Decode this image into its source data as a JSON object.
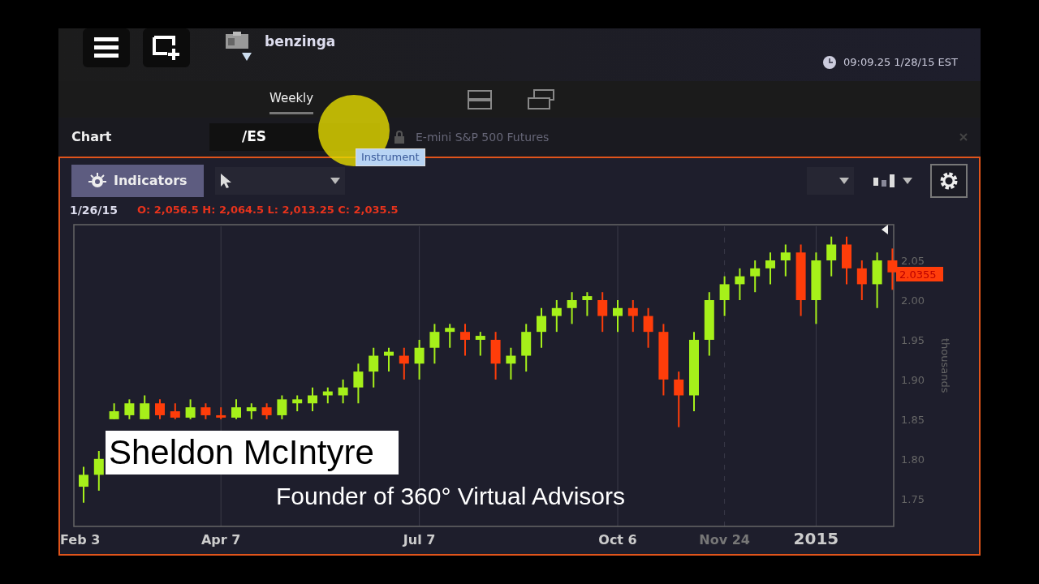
{
  "account": {
    "name": "benzinga"
  },
  "clock": {
    "time": "09:09.25 1/28/15 EST"
  },
  "tabs": [
    {
      "label": "Weekly",
      "selected": true
    }
  ],
  "panel": {
    "title": "Chart",
    "instrument": {
      "value": "/ES"
    },
    "description": "E-mini S&P 500 Futures",
    "tooltip": "Instrument"
  },
  "toolbar": {
    "indicators_button": "Indicators"
  },
  "ohlc": {
    "date": "1/26/15",
    "values": "O: 2,056.5 H: 2,064.5 L: 2,013.25 C: 2,035.5"
  },
  "chart": {
    "price_tag": "2.0355",
    "chart_data": {
      "type": "candlestick",
      "ylabel": "thousands",
      "categories": [
        "Feb 3",
        null,
        null,
        null,
        null,
        null,
        null,
        null,
        null,
        "Apr 7",
        null,
        null,
        null,
        null,
        null,
        null,
        null,
        null,
        null,
        null,
        null,
        null,
        "Jul 7",
        null,
        null,
        null,
        null,
        null,
        null,
        null,
        null,
        null,
        null,
        null,
        null,
        "Oct 6",
        null,
        null,
        null,
        null,
        null,
        null,
        "Nov 24",
        null,
        null,
        null,
        null,
        null,
        "2015",
        null,
        null,
        null,
        null,
        null
      ],
      "ylim": [
        1.715,
        2.095
      ],
      "grid": true,
      "ohlc": [
        [
          1.765,
          1.79,
          1.745,
          1.78
        ],
        [
          1.78,
          1.81,
          1.76,
          1.8
        ],
        [
          1.85,
          1.87,
          1.85,
          1.86
        ],
        [
          1.855,
          1.875,
          1.85,
          1.87
        ],
        [
          1.85,
          1.88,
          1.85,
          1.87
        ],
        [
          1.87,
          1.875,
          1.85,
          1.855
        ],
        [
          1.86,
          1.87,
          1.85,
          1.852
        ],
        [
          1.852,
          1.875,
          1.85,
          1.865
        ],
        [
          1.865,
          1.87,
          1.85,
          1.855
        ],
        [
          1.855,
          1.865,
          1.85,
          1.852
        ],
        [
          1.852,
          1.875,
          1.85,
          1.865
        ],
        [
          1.86,
          1.87,
          1.85,
          1.865
        ],
        [
          1.865,
          1.87,
          1.85,
          1.855
        ],
        [
          1.855,
          1.88,
          1.85,
          1.875
        ],
        [
          1.87,
          1.88,
          1.86,
          1.875
        ],
        [
          1.87,
          1.89,
          1.86,
          1.88
        ],
        [
          1.88,
          1.89,
          1.87,
          1.885
        ],
        [
          1.88,
          1.9,
          1.87,
          1.89
        ],
        [
          1.89,
          1.92,
          1.87,
          1.91
        ],
        [
          1.91,
          1.94,
          1.89,
          1.93
        ],
        [
          1.93,
          1.94,
          1.91,
          1.935
        ],
        [
          1.93,
          1.94,
          1.9,
          1.92
        ],
        [
          1.92,
          1.95,
          1.9,
          1.94
        ],
        [
          1.94,
          1.97,
          1.92,
          1.96
        ],
        [
          1.96,
          1.97,
          1.94,
          1.965
        ],
        [
          1.96,
          1.97,
          1.93,
          1.95
        ],
        [
          1.95,
          1.96,
          1.93,
          1.955
        ],
        [
          1.95,
          1.96,
          1.9,
          1.92
        ],
        [
          1.92,
          1.94,
          1.9,
          1.93
        ],
        [
          1.93,
          1.97,
          1.91,
          1.96
        ],
        [
          1.96,
          1.99,
          1.94,
          1.98
        ],
        [
          1.98,
          2.0,
          1.96,
          1.99
        ],
        [
          1.99,
          2.01,
          1.97,
          2.0
        ],
        [
          2.0,
          2.01,
          1.98,
          2.005
        ],
        [
          2.0,
          2.01,
          1.96,
          1.98
        ],
        [
          1.98,
          2.0,
          1.96,
          1.99
        ],
        [
          1.99,
          2.0,
          1.96,
          1.98
        ],
        [
          1.98,
          1.99,
          1.94,
          1.96
        ],
        [
          1.96,
          1.97,
          1.88,
          1.9
        ],
        [
          1.9,
          1.91,
          1.84,
          1.88
        ],
        [
          1.88,
          1.96,
          1.86,
          1.95
        ],
        [
          1.95,
          2.01,
          1.93,
          2.0
        ],
        [
          2.0,
          2.03,
          1.98,
          2.02
        ],
        [
          2.02,
          2.04,
          2.0,
          2.03
        ],
        [
          2.03,
          2.05,
          2.01,
          2.04
        ],
        [
          2.04,
          2.06,
          2.02,
          2.05
        ],
        [
          2.05,
          2.07,
          2.03,
          2.06
        ],
        [
          2.06,
          2.07,
          1.98,
          2.0
        ],
        [
          2.0,
          2.06,
          1.97,
          2.05
        ],
        [
          2.05,
          2.08,
          2.03,
          2.07
        ],
        [
          2.07,
          2.08,
          2.02,
          2.04
        ],
        [
          2.04,
          2.05,
          2.0,
          2.02
        ],
        [
          2.02,
          2.06,
          1.99,
          2.05
        ],
        [
          2.05,
          2.065,
          2.013,
          2.035
        ]
      ],
      "yticks": [
        {
          "value": 2.05,
          "label": "2.05"
        },
        {
          "value": 2.0,
          "label": "2.00"
        },
        {
          "value": 1.95,
          "label": "1.95"
        },
        {
          "value": 1.9,
          "label": "1.90"
        },
        {
          "value": 1.85,
          "label": "1.85"
        },
        {
          "value": 1.8,
          "label": "1.80"
        },
        {
          "value": 1.75,
          "label": "1.75"
        }
      ]
    }
  },
  "caption": {
    "name": "Sheldon McIntyre",
    "title": "Founder of 360° Virtual Advisors"
  }
}
